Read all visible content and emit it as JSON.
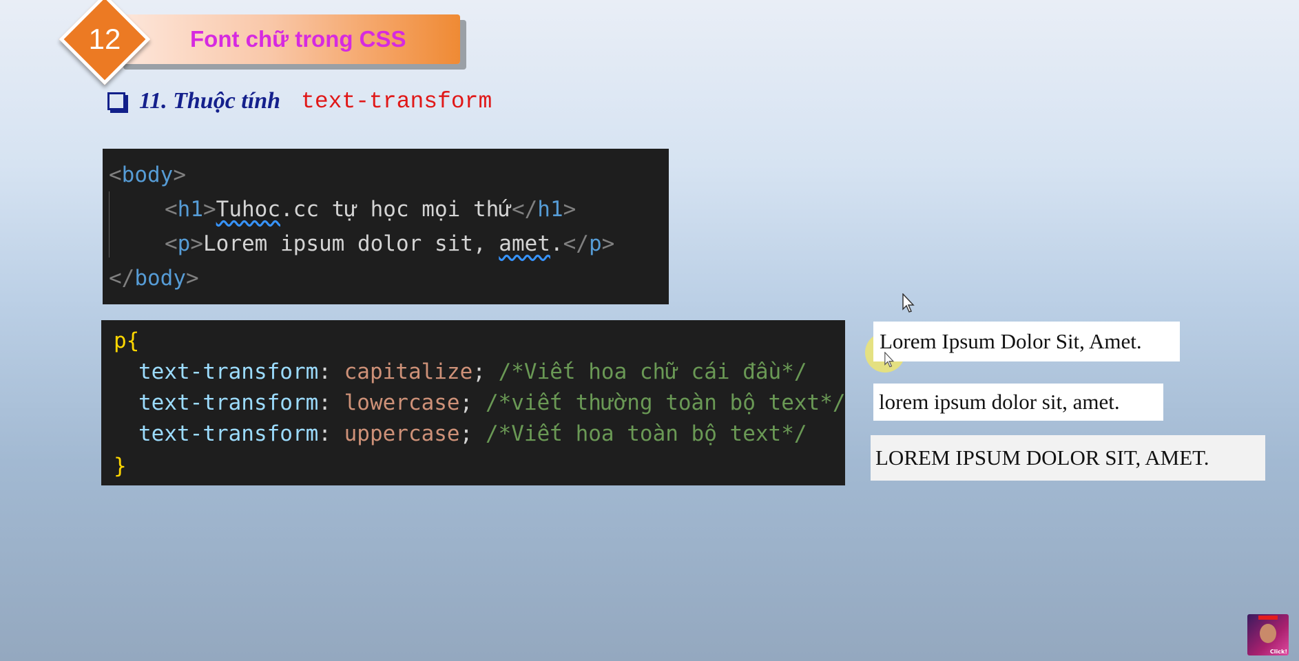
{
  "header": {
    "number": "12",
    "title": "Font chữ trong CSS"
  },
  "heading": {
    "text": "11. Thuộc tính",
    "property": "text-transform"
  },
  "html_code": {
    "body_open": "body",
    "h1_tag": "h1",
    "h1_text_sq": "Tuhoc",
    "h1_text_rest": ".cc tự học mọi thứ",
    "p_tag": "p",
    "p_text_a": "Lorem ipsum dolor sit, ",
    "p_text_sq": "amet",
    "p_text_b": "."
  },
  "css_code": {
    "selector": "p",
    "rules": [
      {
        "property": "text-transform",
        "value": "capitalize",
        "comment": "/*Viết hoa chữ cái đầu*/"
      },
      {
        "property": "text-transform",
        "value": "lowercase",
        "comment": "/*viết thường toàn bộ text*/"
      },
      {
        "property": "text-transform",
        "value": "uppercase",
        "comment": "/*Viết hoa toàn bộ text*/"
      }
    ]
  },
  "previews": {
    "capitalize": "Lorem Ipsum Dolor Sit, Amet.",
    "lowercase": "lorem ipsum dolor sit, amet.",
    "uppercase": "LOREM IPSUM DOLOR SIT, AMET."
  },
  "thumbnail": {
    "label": "Click!"
  }
}
